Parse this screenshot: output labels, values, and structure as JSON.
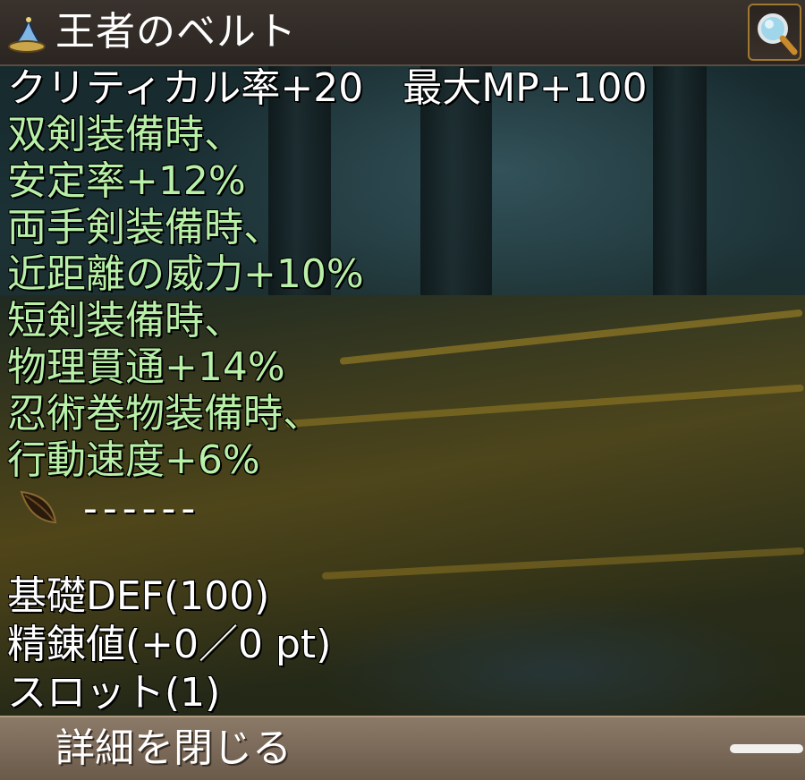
{
  "window": {
    "title": "王者のベルト",
    "title_icon": "wizard-hat-icon",
    "search_icon": "magnifier-icon"
  },
  "stats_header": "クリティカル率+20　最大MP+100",
  "effects": [
    "双剣装備時、",
    "安定率+12%",
    "両手剣装備時、",
    "近距離の威力+10%",
    "短剣装備時、",
    "物理貫通+14%",
    "忍術巻物装備時、",
    "行動速度+6%"
  ],
  "divider": {
    "icon": "leaf-icon",
    "text": "------"
  },
  "base_info": [
    "基礎DEF(100)",
    "精錬値(+0／0 pt)",
    "スロット(1)"
  ],
  "footer": {
    "close_label": "詳細を閉じる"
  },
  "colors": {
    "effect_text": "#b8f0a8",
    "normal_text": "#ffffff",
    "titlebar": "#2f2824",
    "footer": "#7d6c5a"
  }
}
